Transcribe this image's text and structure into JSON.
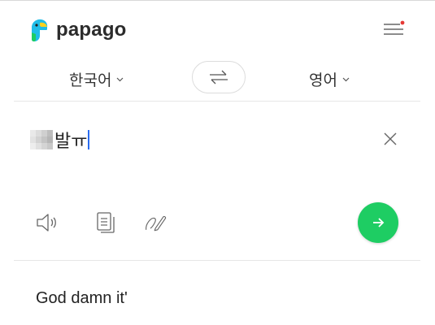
{
  "app": {
    "logo_text": "papago",
    "brand_color": "#1ecd63",
    "menu_badge_color": "#e53935"
  },
  "languages": {
    "source": "한국어",
    "target": "영어",
    "caret_icon": "chevron-down-icon",
    "swap_icon": "swap-arrows-icon"
  },
  "input": {
    "value": "발ㅠ",
    "clear_icon": "close-icon"
  },
  "tools": {
    "speaker_icon": "speaker-icon",
    "copy_icon": "copy-icon",
    "handwriting_icon": "handwriting-pen-icon",
    "translate_icon": "arrow-right-icon"
  },
  "output": {
    "text": "God damn it'"
  }
}
